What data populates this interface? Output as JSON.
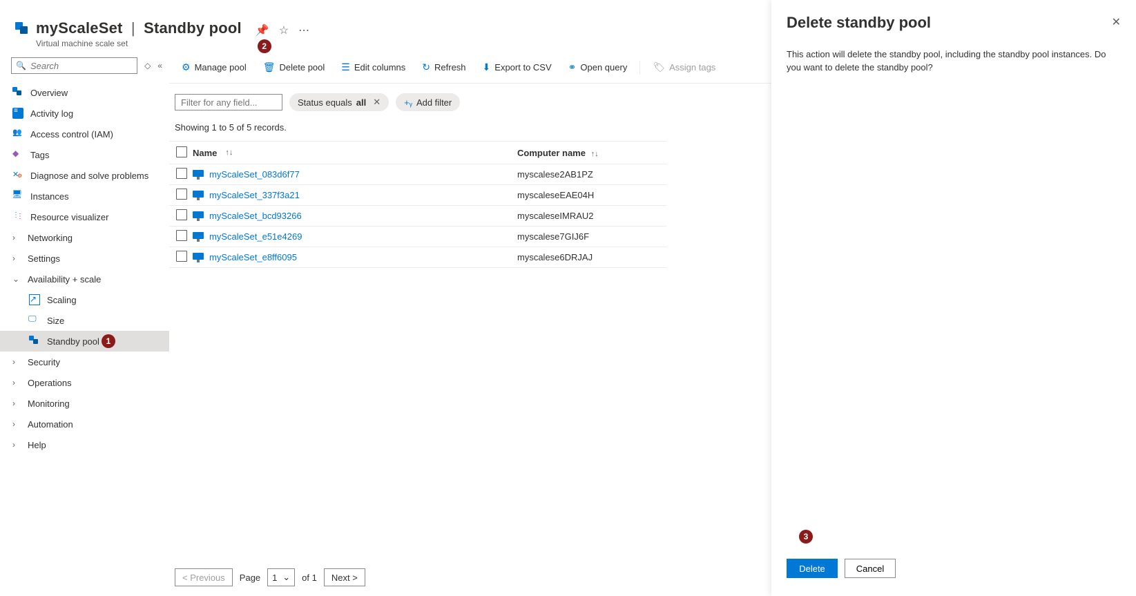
{
  "header": {
    "resource_name": "myScaleSet",
    "section": "Standby pool",
    "subtitle": "Virtual machine scale set"
  },
  "sidebar": {
    "search_placeholder": "Search",
    "items": {
      "overview": "Overview",
      "activity": "Activity log",
      "iam": "Access control (IAM)",
      "tags": "Tags",
      "diagnose": "Diagnose and solve problems",
      "instances": "Instances",
      "resource_visualizer": "Resource visualizer",
      "networking": "Networking",
      "settings": "Settings",
      "availability": "Availability + scale",
      "scaling": "Scaling",
      "size": "Size",
      "standby_pool": "Standby pool",
      "security": "Security",
      "operations": "Operations",
      "monitoring": "Monitoring",
      "automation": "Automation",
      "help": "Help"
    }
  },
  "toolbar": {
    "manage": "Manage pool",
    "delete": "Delete pool",
    "edit_columns": "Edit columns",
    "refresh": "Refresh",
    "export": "Export to CSV",
    "open_query": "Open query",
    "assign_tags": "Assign tags"
  },
  "filters": {
    "filter_placeholder": "Filter for any field...",
    "status_prefix": "Status equals",
    "status_value": "all",
    "add_filter": "Add filter"
  },
  "table": {
    "record_text": "Showing 1 to 5 of 5 records.",
    "col_name": "Name",
    "col_computer": "Computer name",
    "rows": [
      {
        "name": "myScaleSet_083d6f77",
        "computer": "myscalese2AB1PZ"
      },
      {
        "name": "myScaleSet_337f3a21",
        "computer": "myscaleseEAE04H"
      },
      {
        "name": "myScaleSet_bcd93266",
        "computer": "myscaleseIMRAU2"
      },
      {
        "name": "myScaleSet_e51e4269",
        "computer": "myscalese7GIJ6F"
      },
      {
        "name": "myScaleSet_e8ff6095",
        "computer": "myscalese6DRJAJ"
      }
    ]
  },
  "pager": {
    "previous": "< Previous",
    "page_label": "Page",
    "page": "1",
    "of_label": "of 1",
    "next": "Next >"
  },
  "panel": {
    "title": "Delete standby pool",
    "body": "This action will delete the standby pool, including the standby pool instances. Do you want to delete the standby pool?",
    "delete_btn": "Delete",
    "cancel_btn": "Cancel"
  },
  "callouts": {
    "c1": "1",
    "c2": "2",
    "c3": "3"
  }
}
